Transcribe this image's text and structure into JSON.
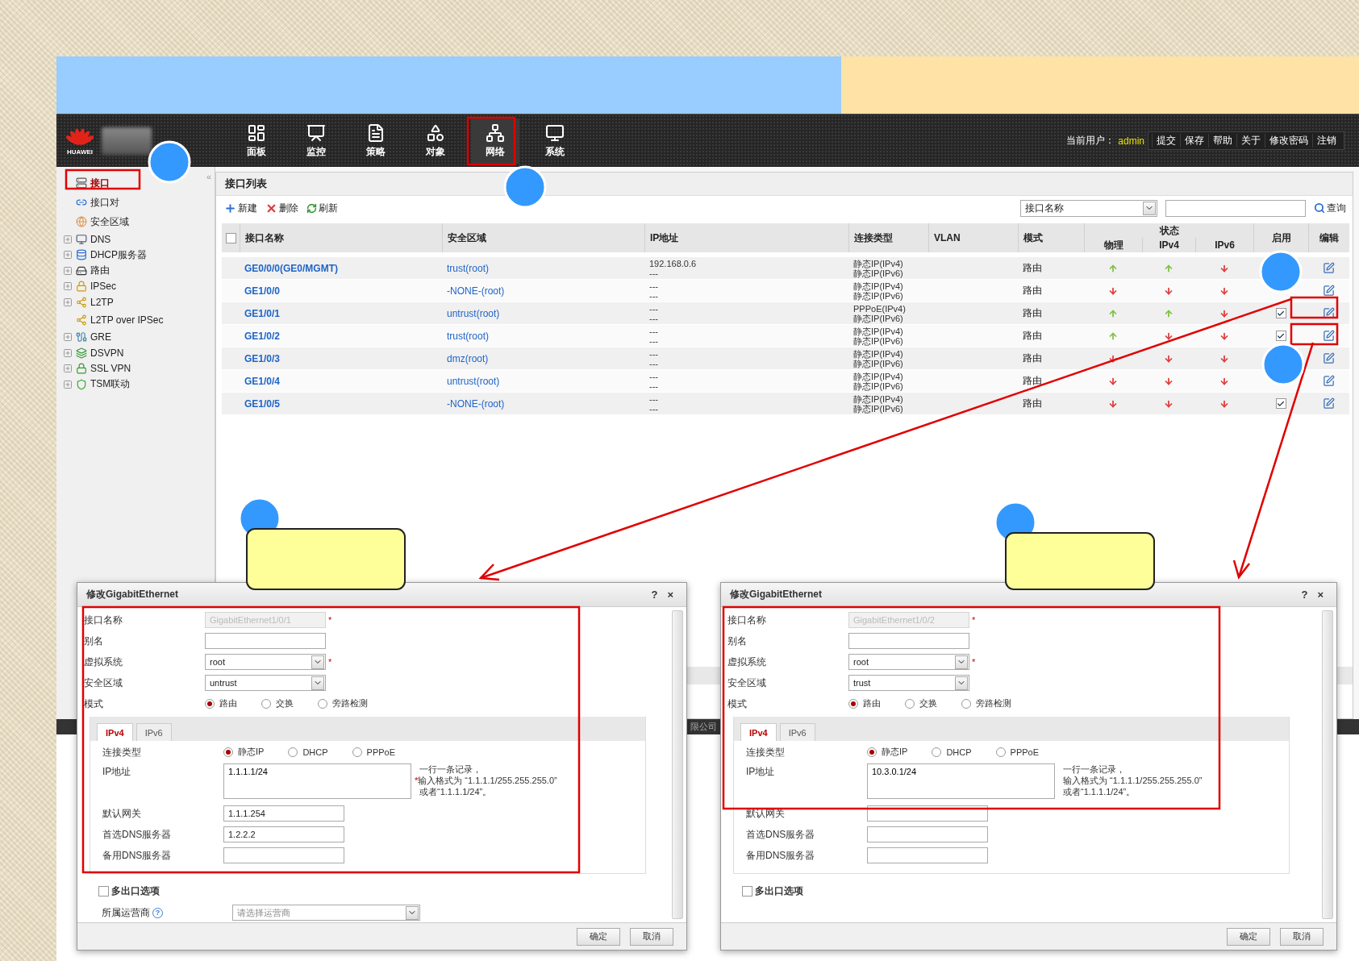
{
  "header": {
    "logo_text": "HUAWEI",
    "nav": [
      {
        "label": "面板",
        "selected": false
      },
      {
        "label": "监控",
        "selected": false
      },
      {
        "label": "策略",
        "selected": false
      },
      {
        "label": "对象",
        "selected": false
      },
      {
        "label": "网络",
        "selected": true
      },
      {
        "label": "系统",
        "selected": false
      }
    ],
    "user_label": "当前用户：",
    "user": "admin",
    "links": [
      "提交",
      "保存",
      "帮助",
      "关于",
      "修改密码",
      "注销"
    ]
  },
  "sidebar": {
    "collapse": "«",
    "items": [
      {
        "label": "接口",
        "selected": true,
        "expandable": false
      },
      {
        "label": "接口对",
        "selected": false,
        "expandable": false
      },
      {
        "label": "安全区域",
        "selected": false,
        "expandable": false
      },
      {
        "label": "DNS",
        "selected": false,
        "expandable": true
      },
      {
        "label": "DHCP服务器",
        "selected": false,
        "expandable": true
      },
      {
        "label": "路由",
        "selected": false,
        "expandable": true
      },
      {
        "label": "IPSec",
        "selected": false,
        "expandable": true
      },
      {
        "label": "L2TP",
        "selected": false,
        "expandable": true
      },
      {
        "label": "L2TP over IPSec",
        "selected": false,
        "expandable": false
      },
      {
        "label": "GRE",
        "selected": false,
        "expandable": true
      },
      {
        "label": "DSVPN",
        "selected": false,
        "expandable": true
      },
      {
        "label": "SSL VPN",
        "selected": false,
        "expandable": true
      },
      {
        "label": "TSM联动",
        "selected": false,
        "expandable": true
      }
    ]
  },
  "panel": {
    "title": "接口列表",
    "toolbar": [
      "新建",
      "删除",
      "刷新"
    ],
    "search_field": "接口名称",
    "search_button": "查询"
  },
  "table": {
    "all_checked": false,
    "columns": [
      "接口名称",
      "安全区域",
      "IP地址",
      "连接类型",
      "VLAN",
      "模式"
    ],
    "status_group": "状态",
    "status_columns": [
      "物理",
      "IPv4",
      "IPv6"
    ],
    "enable_column": "启用",
    "edit_column": "编辑",
    "rows": [
      {
        "name": "GE0/0/0(GE0/MGMT)",
        "zone": "trust(root)",
        "ip": [
          "192.168.0.6",
          "---"
        ],
        "connection": [
          "静态IP(IPv4)",
          "静态IP(IPv6)"
        ],
        "mode": "路由",
        "physical_up": true,
        "ipv4_up": true,
        "ipv6_up": false
      },
      {
        "name": "GE1/0/0",
        "zone": "-NONE-(root)",
        "ip": [
          "---",
          "---"
        ],
        "connection": [
          "静态IP(IPv4)",
          "静态IP(IPv6)"
        ],
        "mode": "路由",
        "physical_up": false,
        "ipv4_up": false,
        "ipv6_up": false
      },
      {
        "name": "GE1/0/1",
        "zone": "untrust(root)",
        "ip": [
          "---",
          "---"
        ],
        "connection": [
          "PPPoE(IPv4)",
          "静态IP(IPv6)"
        ],
        "mode": "路由",
        "physical_up": true,
        "ipv4_up": true,
        "ipv6_up": false,
        "enabled": true
      },
      {
        "name": "GE1/0/2",
        "zone": "trust(root)",
        "ip": [
          "---",
          "---"
        ],
        "connection": [
          "静态IP(IPv4)",
          "静态IP(IPv6)"
        ],
        "mode": "路由",
        "physical_up": true,
        "ipv4_up": false,
        "ipv6_up": false,
        "enabled": true
      },
      {
        "name": "GE1/0/3",
        "zone": "dmz(root)",
        "ip": [
          "---",
          "---"
        ],
        "connection": [
          "静态IP(IPv4)",
          "静态IP(IPv6)"
        ],
        "mode": "路由",
        "physical_up": false,
        "ipv4_up": false,
        "ipv6_up": false
      },
      {
        "name": "GE1/0/4",
        "zone": "untrust(root)",
        "ip": [
          "---",
          "---"
        ],
        "connection": [
          "静态IP(IPv4)",
          "静态IP(IPv6)"
        ],
        "mode": "路由",
        "physical_up": false,
        "ipv4_up": false,
        "ipv6_up": false
      },
      {
        "name": "GE1/0/5",
        "zone": "-NONE-(root)",
        "ip": [
          "---",
          "---"
        ],
        "connection": [
          "静态IP(IPv4)",
          "静态IP(IPv6)"
        ],
        "mode": "路由",
        "physical_up": false,
        "ipv4_up": false,
        "ipv6_up": false,
        "enabled": true
      }
    ]
  },
  "footer": {
    "text": "限公司"
  },
  "dialogs": [
    {
      "title": "修改GigabitEthernet",
      "help": "?",
      "close": "×",
      "fields": [
        {
          "kind": "text",
          "label": "接口名称",
          "value": "GigabitEthernet1/0/1",
          "disabled": true,
          "mark": "*"
        },
        {
          "kind": "text",
          "label": "别名",
          "disabled": false
        },
        {
          "kind": "select",
          "label": "虚拟系统",
          "value": "root",
          "disabled": false,
          "mark": "*"
        },
        {
          "kind": "select",
          "label": "安全区域",
          "value": "untrust",
          "disabled": false
        },
        {
          "kind": "radio",
          "label": "模式",
          "options": [
            {
              "label": "路由",
              "selected": true
            },
            {
              "label": "交换",
              "selected": false
            },
            {
              "label": "旁路检测",
              "selected": false
            }
          ]
        }
      ],
      "tabs": [
        {
          "label": "IPv4",
          "selected": true
        },
        {
          "label": "IPv6",
          "selected": false
        }
      ],
      "ip_fields": [
        {
          "kind": "radio",
          "label": "连接类型",
          "options": [
            {
              "label": "静态IP",
              "selected": true
            },
            {
              "label": "DHCP",
              "selected": false
            },
            {
              "label": "PPPoE",
              "selected": false
            }
          ]
        },
        {
          "kind": "textarea",
          "label": "IP地址",
          "value": "1.1.1.1/24",
          "mark": "*",
          "hint": [
            "一行一条记录，",
            "输入格式为 “1.1.1.1/255.255.255.0”",
            "或者“1.1.1.1/24”。"
          ]
        },
        {
          "kind": "text",
          "label": "默认网关",
          "value": "1.1.1.254"
        },
        {
          "kind": "text",
          "label": "首选DNS服务器",
          "value": "1.2.2.2"
        },
        {
          "kind": "text",
          "label": "备用DNS服务器"
        }
      ],
      "multi_exit": {
        "label": "多出口选项",
        "checked": false
      },
      "isp": {
        "label": "所属运营商",
        "help": "?",
        "placeholder": "请选择运营商"
      },
      "buttons": [
        "确定",
        "取消"
      ]
    },
    {
      "title": "修改GigabitEthernet",
      "help": "?",
      "close": "×",
      "fields": [
        {
          "kind": "text",
          "label": "接口名称",
          "value": "GigabitEthernet1/0/2",
          "disabled": true,
          "mark": "*"
        },
        {
          "kind": "text",
          "label": "别名",
          "disabled": false
        },
        {
          "kind": "select",
          "label": "虚拟系统",
          "value": "root",
          "disabled": false,
          "mark": "*"
        },
        {
          "kind": "select",
          "label": "安全区域",
          "value": "trust",
          "disabled": false
        },
        {
          "kind": "radio",
          "label": "模式",
          "options": [
            {
              "label": "路由",
              "selected": true
            },
            {
              "label": "交换",
              "selected": false
            },
            {
              "label": "旁路检测",
              "selected": false
            }
          ]
        }
      ],
      "tabs": [
        {
          "label": "IPv4",
          "selected": true
        },
        {
          "label": "IPv6",
          "selected": false
        }
      ],
      "ip_fields": [
        {
          "kind": "radio",
          "label": "连接类型",
          "options": [
            {
              "label": "静态IP",
              "selected": true
            },
            {
              "label": "DHCP",
              "selected": false
            },
            {
              "label": "PPPoE",
              "selected": false
            }
          ]
        },
        {
          "kind": "textarea",
          "label": "IP地址",
          "value": "10.3.0.1/24",
          "hint": [
            "一行一条记录，",
            "输入格式为 “1.1.1.1/255.255.255.0”",
            "或者“1.1.1.1/24”。"
          ]
        },
        {
          "kind": "text",
          "label": "默认网关"
        },
        {
          "kind": "text",
          "label": "首选DNS服务器"
        },
        {
          "kind": "text",
          "label": "备用DNS服务器"
        }
      ],
      "multi_exit": {
        "label": "多出口选项",
        "checked": false
      },
      "buttons": [
        "确定",
        "取消"
      ]
    }
  ]
}
